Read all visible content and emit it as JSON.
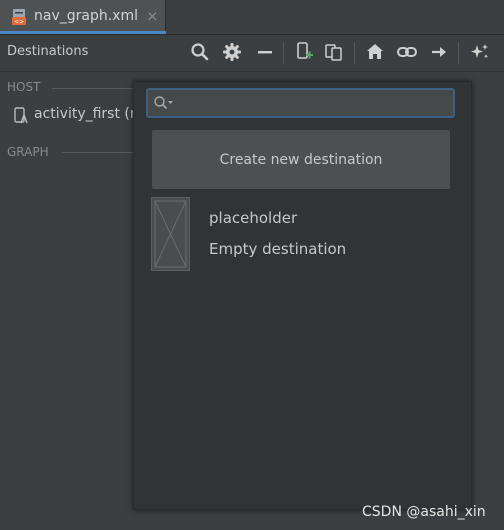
{
  "tab": {
    "label": "nav_graph.xml",
    "close_glyph": "×",
    "icon": "xml-file-icon"
  },
  "toolbar": {
    "title": "Destinations",
    "icons": [
      "search-icon",
      "gear-icon",
      "collapse-icon",
      "new-destination-icon",
      "screen-overlap-icon",
      "home-icon",
      "link-icon",
      "arrow-right-icon",
      "auto-arrange-icon"
    ]
  },
  "panel": {
    "host_label": "HOST",
    "host_item": "activity_first (r",
    "graph_label": "GRAPH"
  },
  "popup": {
    "search": {
      "value": "",
      "placeholder": ""
    },
    "create_label": "Create new destination",
    "destination": {
      "name": "placeholder",
      "subtitle": "Empty destination"
    }
  },
  "watermark": "CSDN @asahi_xin",
  "colors": {
    "accent": "#4a88c7",
    "background": "#3c3f41",
    "popup": "#313335",
    "new_badge": "#59a869"
  }
}
